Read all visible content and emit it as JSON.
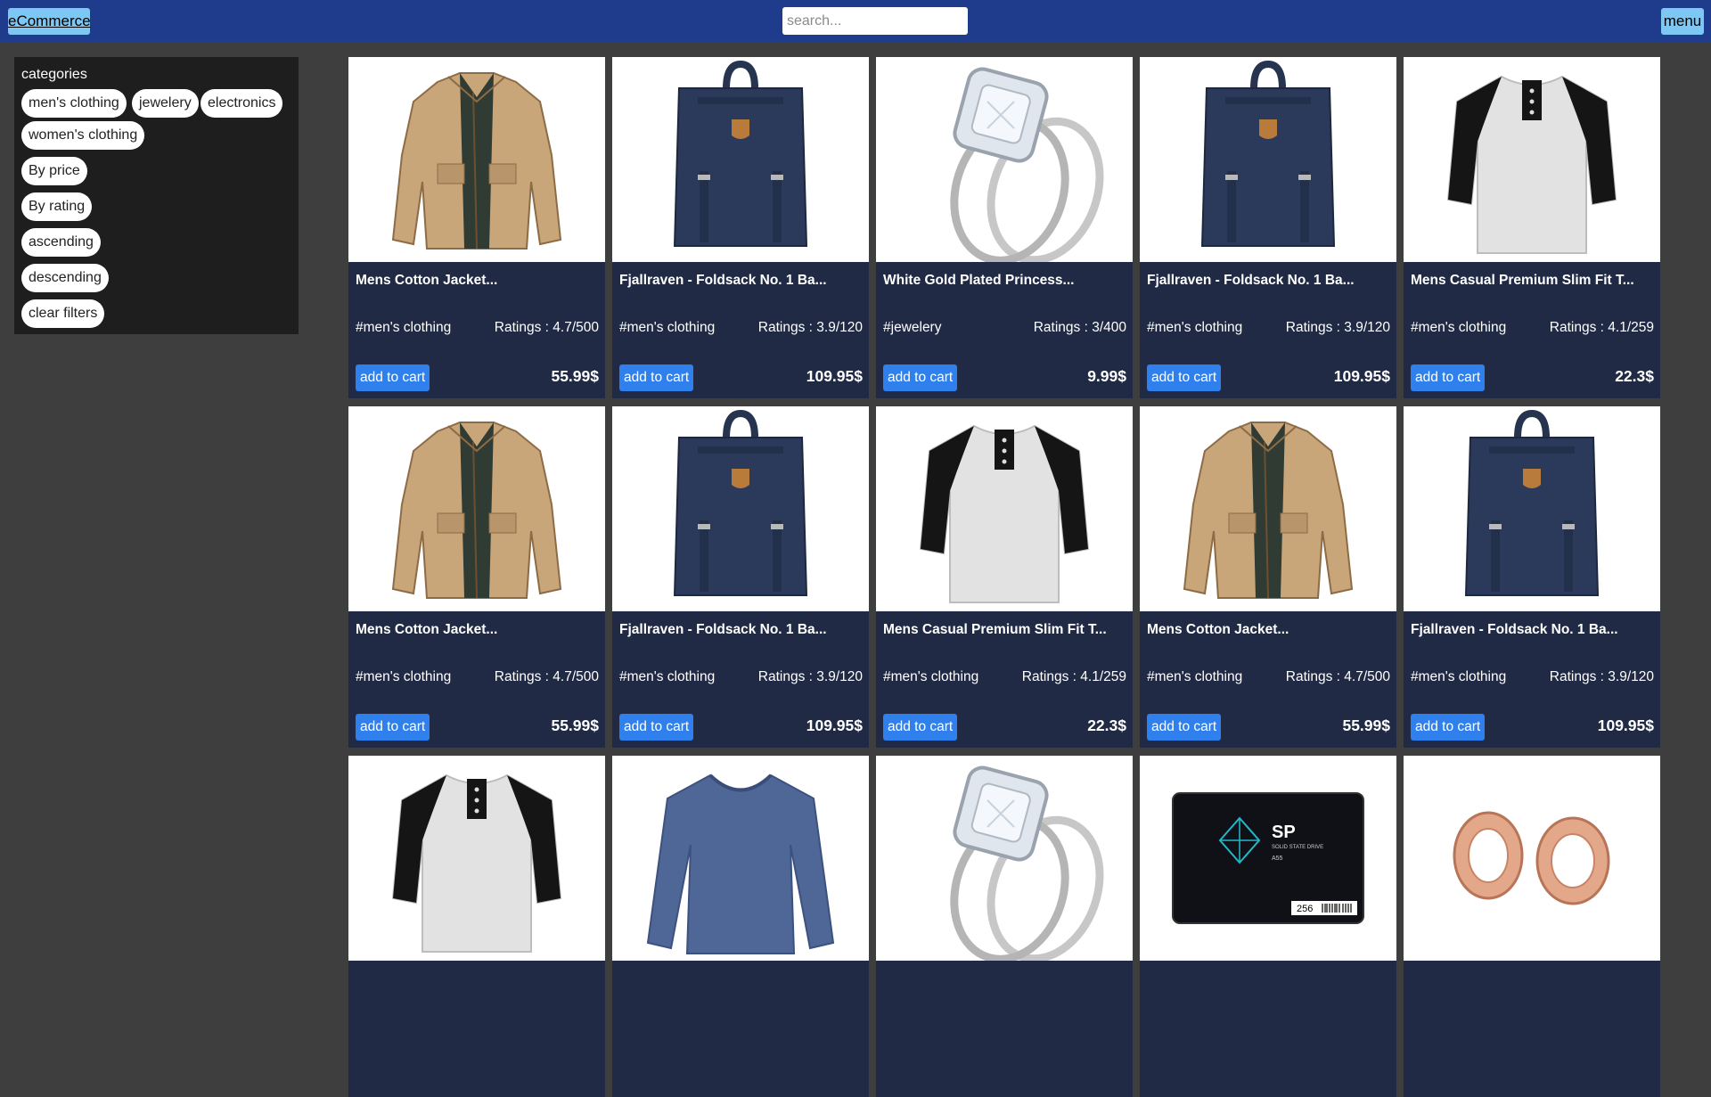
{
  "header": {
    "brand": "eCommerce",
    "search_placeholder": "search...",
    "search_value": "",
    "menu": "menu"
  },
  "sidebar": {
    "title": "categories",
    "categories": [
      "men's clothing",
      "jewelery",
      "electronics",
      "women's clothing"
    ],
    "sort": [
      "By price",
      "By rating",
      "ascending",
      "descending",
      "clear filters"
    ]
  },
  "colors": {
    "header": "#1f3b8c",
    "brand_button": "#7cc7f4",
    "card_footer": "#202a45",
    "add_button": "#2f80ed"
  },
  "products": [
    {
      "title": "Mens Cotton Jacket...",
      "category": "#men's clothing",
      "rating": "Ratings : 4.7/500",
      "add": "add to cart",
      "price": "55.99$",
      "image": "jacket"
    },
    {
      "title": "Fjallraven - Foldsack No. 1 Ba...",
      "category": "#men's clothing",
      "rating": "Ratings : 3.9/120",
      "add": "add to cart",
      "price": "109.95$",
      "image": "backpack"
    },
    {
      "title": "White Gold Plated Princess...",
      "category": "#jewelery",
      "rating": "Ratings : 3/400",
      "add": "add to cart",
      "price": "9.99$",
      "image": "ring"
    },
    {
      "title": "Fjallraven - Foldsack No. 1 Ba...",
      "category": "#men's clothing",
      "rating": "Ratings : 3.9/120",
      "add": "add to cart",
      "price": "109.95$",
      "image": "backpack"
    },
    {
      "title": "Mens Casual Premium Slim Fit T...",
      "category": "#men's clothing",
      "rating": "Ratings : 4.1/259",
      "add": "add to cart",
      "price": "22.3$",
      "image": "raglan"
    },
    {
      "title": "Mens Cotton Jacket...",
      "category": "#men's clothing",
      "rating": "Ratings : 4.7/500",
      "add": "add to cart",
      "price": "55.99$",
      "image": "jacket"
    },
    {
      "title": "Fjallraven - Foldsack No. 1 Ba...",
      "category": "#men's clothing",
      "rating": "Ratings : 3.9/120",
      "add": "add to cart",
      "price": "109.95$",
      "image": "backpack"
    },
    {
      "title": "Mens Casual Premium Slim Fit T...",
      "category": "#men's clothing",
      "rating": "Ratings : 4.1/259",
      "add": "add to cart",
      "price": "22.3$",
      "image": "raglan"
    },
    {
      "title": "Mens Cotton Jacket...",
      "category": "#men's clothing",
      "rating": "Ratings : 4.7/500",
      "add": "add to cart",
      "price": "55.99$",
      "image": "jacket"
    },
    {
      "title": "Fjallraven - Foldsack No. 1 Ba...",
      "category": "#men's clothing",
      "rating": "Ratings : 3.9/120",
      "add": "add to cart",
      "price": "109.95$",
      "image": "backpack"
    },
    {
      "title": "",
      "category": "",
      "rating": "",
      "add": "",
      "price": "",
      "image": "raglan"
    },
    {
      "title": "",
      "category": "",
      "rating": "",
      "add": "",
      "price": "",
      "image": "longsleeve"
    },
    {
      "title": "",
      "category": "",
      "rating": "",
      "add": "",
      "price": "",
      "image": "ring"
    },
    {
      "title": "",
      "category": "",
      "rating": "",
      "add": "",
      "price": "",
      "image": "ssd"
    },
    {
      "title": "",
      "category": "",
      "rating": "",
      "add": "",
      "price": "",
      "image": "earrings"
    }
  ],
  "ssd_label": {
    "brand": "SP",
    "line1": "SOLID STATE DRIVE",
    "model": "A55",
    "capacity": "256"
  }
}
